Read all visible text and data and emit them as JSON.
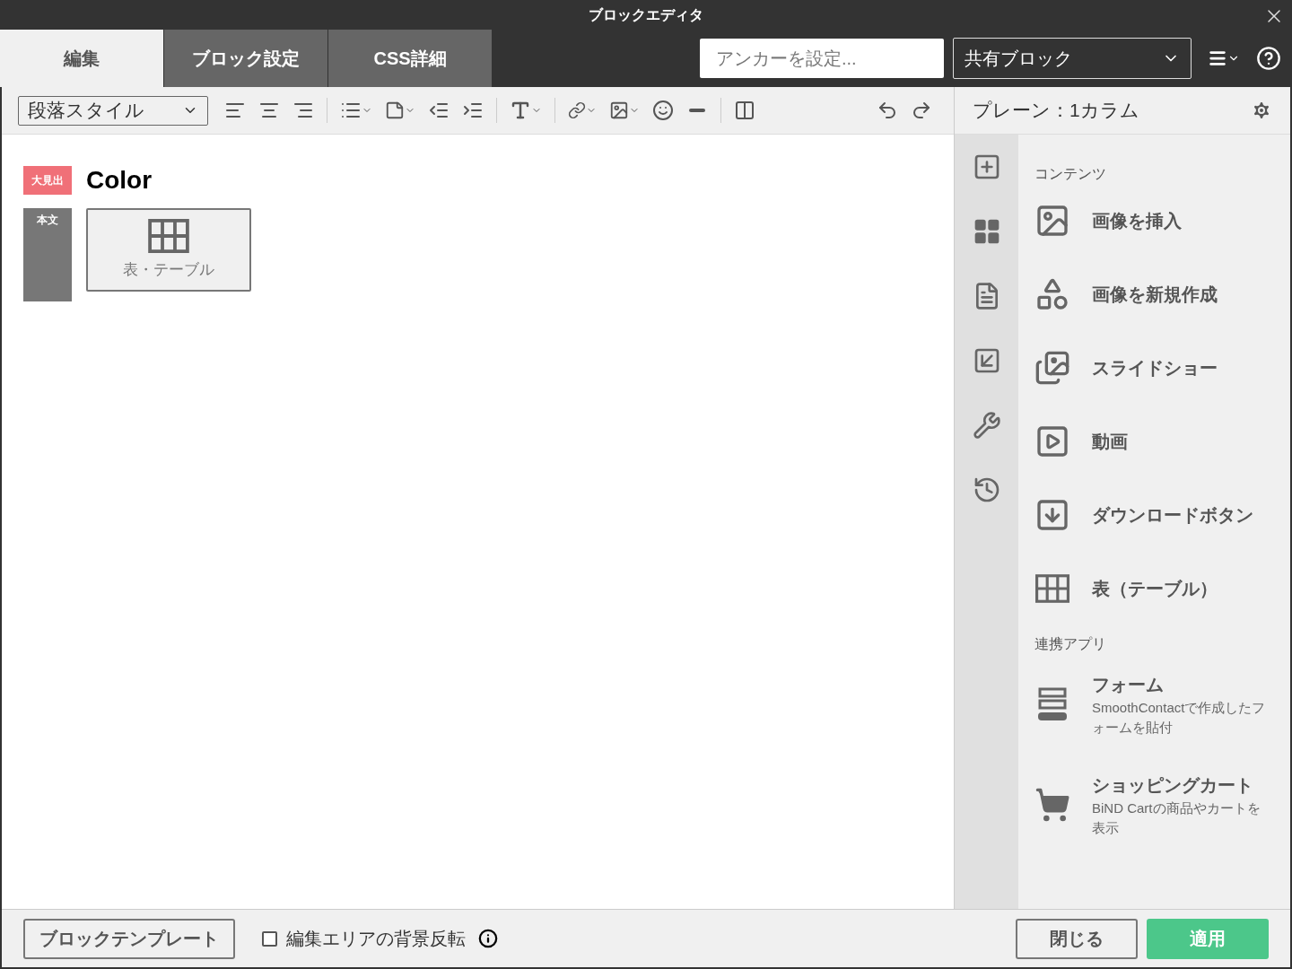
{
  "window": {
    "title": "ブロックエディタ"
  },
  "tabs": [
    {
      "label": "編集",
      "selected": true
    },
    {
      "label": "ブロック設定",
      "selected": false
    },
    {
      "label": "CSS詳細",
      "selected": false
    }
  ],
  "anchor_field": {
    "placeholder": "アンカーを設定..."
  },
  "shared_block_select": {
    "value": "共有ブロック"
  },
  "toolbar": {
    "paragraph_style": "段落スタイル"
  },
  "editor": {
    "blocks": [
      {
        "kind": "heading",
        "tag": "大見出",
        "text": "Color"
      },
      {
        "kind": "body",
        "tag": "本文",
        "placeholder": "表・テーブル"
      }
    ]
  },
  "panel": {
    "title": "プレーン：1カラム",
    "sections": [
      {
        "heading": "コンテンツ",
        "items": [
          {
            "label": "画像を挿入"
          },
          {
            "label": "画像を新規作成"
          },
          {
            "label": "スライドショー"
          },
          {
            "label": "動画"
          },
          {
            "label": "ダウンロードボタン"
          },
          {
            "label": "表（テーブル）"
          }
        ]
      },
      {
        "heading": "連携アプリ",
        "items": [
          {
            "label": "フォーム",
            "description": "SmoothContactで作成したフォームを貼付"
          },
          {
            "label": "ショッピングカート",
            "description": "BiND Cartの商品やカートを表示"
          }
        ]
      }
    ]
  },
  "footer": {
    "template_button": "ブロックテンプレート",
    "invert_checkbox": {
      "label": "編集エリアの背景反転",
      "checked": false
    },
    "close_button": "閉じる",
    "apply_button": "適用"
  }
}
